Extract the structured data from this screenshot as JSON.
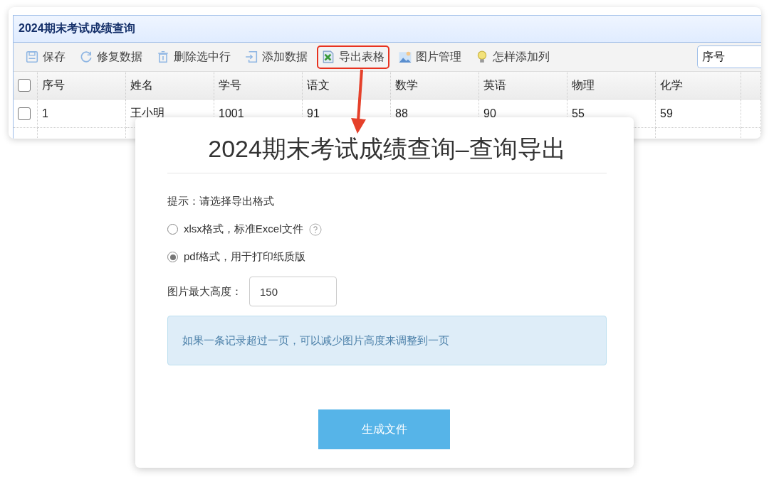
{
  "window": {
    "title": "2024期末考试成绩查询",
    "toolbar": [
      {
        "label": "保存",
        "highlighted": false
      },
      {
        "label": "修复数据",
        "highlighted": false
      },
      {
        "label": "删除选中行",
        "highlighted": false
      },
      {
        "label": "添加数据",
        "highlighted": false
      },
      {
        "label": "导出表格",
        "highlighted": true
      },
      {
        "label": "图片管理",
        "highlighted": false
      },
      {
        "label": "怎样添加列",
        "highlighted": false
      }
    ],
    "search": {
      "value": "序号"
    }
  },
  "table": {
    "all_checked": false,
    "columns": [
      "序号",
      "姓名",
      "学号",
      "语文",
      "数学",
      "英语",
      "物理",
      "化学"
    ],
    "rows": [
      {
        "checked": false,
        "cells": [
          "1",
          "王小明",
          "1001",
          "91",
          "88",
          "90",
          "55",
          "59"
        ]
      }
    ]
  },
  "dialog": {
    "title": "2024期末考试成绩查询–查询导出",
    "hint": "提示：请选择导出格式",
    "options": [
      {
        "label": "xlsx格式，标准Excel文件",
        "selected": false,
        "help": true
      },
      {
        "label": "pdf格式，用于打印纸质版",
        "selected": true,
        "help": false
      }
    ],
    "height_label": "图片最大高度：",
    "height_value": "150",
    "notice": "如果一条记录超过一页，可以减少图片高度来调整到一页",
    "button": "生成文件"
  }
}
